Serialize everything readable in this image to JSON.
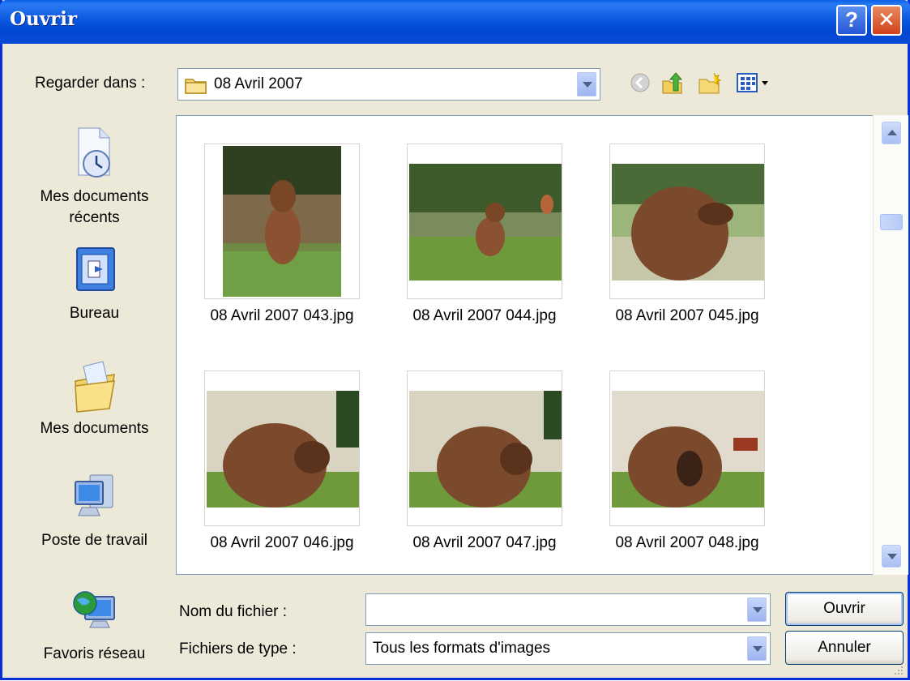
{
  "window": {
    "title": "Ouvrir"
  },
  "title_buttons": {
    "help": "?",
    "close": "✕"
  },
  "look_in": {
    "label": "Regarder dans :",
    "value": "08 Avril 2007"
  },
  "toolbar_icons": [
    "back-icon",
    "up-folder-icon",
    "new-folder-icon",
    "view-menu-icon"
  ],
  "places": [
    {
      "label": "Mes documents récents",
      "icon": "recent-documents-icon"
    },
    {
      "label": "Bureau",
      "icon": "desktop-icon"
    },
    {
      "label": "Mes documents",
      "icon": "my-documents-icon"
    },
    {
      "label": "Poste de travail",
      "icon": "my-computer-icon"
    },
    {
      "label": "Favoris réseau",
      "icon": "network-places-icon"
    }
  ],
  "files": [
    {
      "name": "08 Avril 2007 043.jpg"
    },
    {
      "name": "08 Avril 2007 044.jpg"
    },
    {
      "name": "08 Avril 2007 045.jpg"
    },
    {
      "name": "08 Avril 2007 046.jpg"
    },
    {
      "name": "08 Avril 2007 047.jpg"
    },
    {
      "name": "08 Avril 2007 048.jpg"
    }
  ],
  "filename": {
    "label": "Nom du fichier :",
    "value": ""
  },
  "filetype": {
    "label": "Fichiers de type :",
    "value": "Tous les formats d'images"
  },
  "buttons": {
    "open": "Ouvrir",
    "cancel": "Annuler"
  },
  "colors": {
    "title_bar": "#0148d1",
    "dialog_bg": "#ece9d8",
    "border": "#7f9db9"
  }
}
